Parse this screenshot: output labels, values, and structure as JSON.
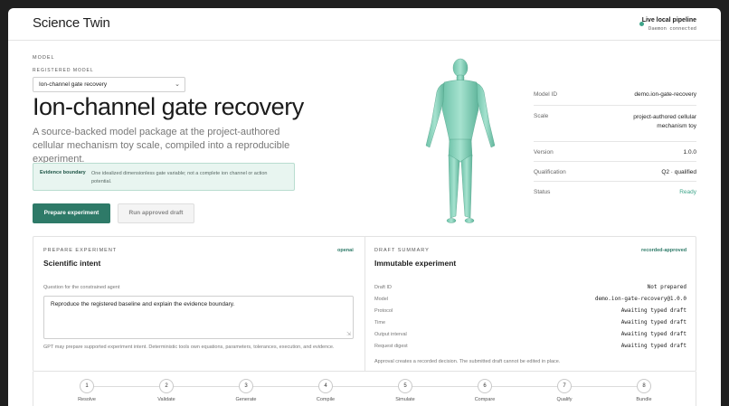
{
  "header": {
    "app_title": "Science Twin",
    "status_title": "Live local pipeline",
    "status_sub": "Daemon connected"
  },
  "model": {
    "section_label": "Model",
    "registered_label": "Registered model",
    "selected": "Ion-channel gate recovery",
    "title": "Ion-channel gate recovery",
    "description": "A source-backed model package at the project-authored cellular mechanism toy scale, compiled into a reproducible experiment.",
    "evidence_label": "Evidence boundary",
    "evidence_text": "One idealized dimensionless gate variable; not a complete ion channel or action potential.",
    "prepare_button": "Prepare experiment",
    "run_button": "Run approved draft"
  },
  "meta": [
    {
      "key": "Model ID",
      "value": "demo.ion-gate-recovery"
    },
    {
      "key": "Scale",
      "value": "project-authored cellular mechanism toy"
    },
    {
      "key": "Version",
      "value": "1.0.0"
    },
    {
      "key": "Qualification",
      "value": "Q2 · qualified"
    },
    {
      "key": "Status",
      "value": "Ready"
    }
  ],
  "prepare": {
    "section_label": "Prepare experiment",
    "tag": "openai",
    "title": "Scientific intent",
    "question_label": "Question for the constrained agent",
    "question_value": "Reproduce the registered baseline and explain the evidence boundary.",
    "footnote": "GPT may prepare supported experiment intent. Deterministic tools own equations, parameters, tolerances, execution, and evidence."
  },
  "draft": {
    "section_label": "Draft summary",
    "tag": "recorded-approved",
    "title": "Immutable experiment",
    "rows": [
      {
        "key": "Draft ID",
        "value": "Not prepared"
      },
      {
        "key": "Model",
        "value": "demo.ion-gate-recovery@1.0.0"
      },
      {
        "key": "Protocol",
        "value": "Awaiting typed draft"
      },
      {
        "key": "Time",
        "value": "Awaiting typed draft"
      },
      {
        "key": "Output interval",
        "value": "Awaiting typed draft"
      },
      {
        "key": "Request digest",
        "value": "Awaiting typed draft"
      }
    ],
    "footnote": "Approval creates a recorded decision. The submitted draft cannot be edited in place."
  },
  "steps": [
    {
      "num": "1",
      "label": "Resolve"
    },
    {
      "num": "2",
      "label": "Validate"
    },
    {
      "num": "3",
      "label": "Generate"
    },
    {
      "num": "4",
      "label": "Compile"
    },
    {
      "num": "5",
      "label": "Simulate"
    },
    {
      "num": "6",
      "label": "Compare"
    },
    {
      "num": "7",
      "label": "Qualify"
    },
    {
      "num": "8",
      "label": "Bundle"
    }
  ],
  "colors": {
    "accent": "#2e7a68",
    "status_ready": "#3fa58a",
    "evidence_bg": "#e8f5f0",
    "figure": "#8ad3bd"
  },
  "icons": {
    "live_status": "dot-icon",
    "select_chevron": "chevron-down-icon",
    "figure": "human-body-figure"
  }
}
